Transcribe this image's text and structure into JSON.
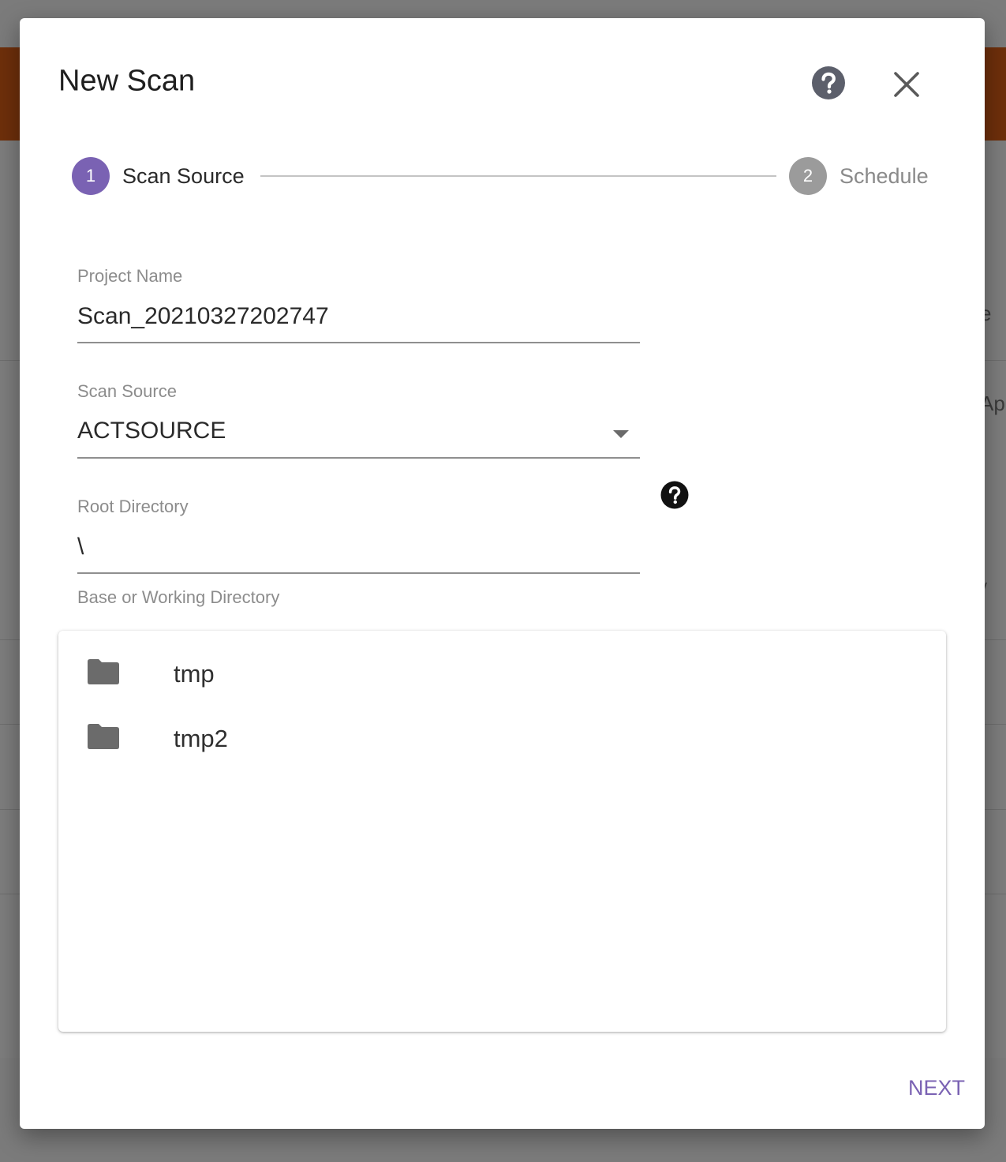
{
  "background": {
    "fragments": [
      "e",
      "Apr",
      "v"
    ]
  },
  "dialog": {
    "title": "New Scan",
    "help_icon": "help-circle-icon",
    "close_icon": "close-icon"
  },
  "stepper": {
    "steps": [
      {
        "number": "1",
        "label": "Scan Source",
        "state": "active"
      },
      {
        "number": "2",
        "label": "Schedule",
        "state": "inactive"
      }
    ]
  },
  "form": {
    "project_name": {
      "label": "Project Name",
      "value": "Scan_20210327202747"
    },
    "scan_source": {
      "label": "Scan Source",
      "value": "ACTSOURCE"
    },
    "root_directory": {
      "label": "Root Directory",
      "value": "\\",
      "hint": "Base or Working Directory"
    }
  },
  "directory_list": {
    "items": [
      {
        "name": "tmp",
        "icon": "folder-icon"
      },
      {
        "name": "tmp2",
        "icon": "folder-icon"
      }
    ]
  },
  "footer": {
    "next_label": "NEXT"
  },
  "colors": {
    "accent": "#7a62b3",
    "header_bar": "#6e2f0b",
    "inactive_step": "#9b9b9b"
  }
}
